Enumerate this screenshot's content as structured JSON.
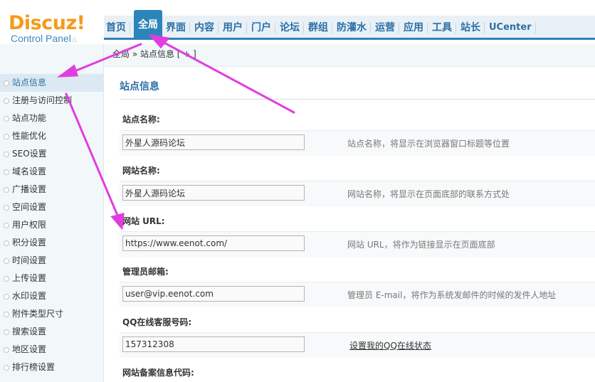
{
  "header": {
    "logo_main": "Discuz!",
    "logo_sub": "Control Panel",
    "home_icon": "home-icon"
  },
  "nav": {
    "items": [
      {
        "label": "首页",
        "active": false
      },
      {
        "label": "全局",
        "active": true
      },
      {
        "label": "界面",
        "active": false
      },
      {
        "label": "内容",
        "active": false
      },
      {
        "label": "用户",
        "active": false
      },
      {
        "label": "门户",
        "active": false
      },
      {
        "label": "论坛",
        "active": false
      },
      {
        "label": "群组",
        "active": false
      },
      {
        "label": "防灌水",
        "active": false
      },
      {
        "label": "运营",
        "active": false
      },
      {
        "label": "应用",
        "active": false
      },
      {
        "label": "工具",
        "active": false
      },
      {
        "label": "站长",
        "active": false
      },
      {
        "label": "UCenter",
        "active": false
      }
    ]
  },
  "breadcrumb": {
    "text": "全局 » 站点信息 [ + ]"
  },
  "sidebar": {
    "items": [
      {
        "label": "站点信息",
        "active": true
      },
      {
        "label": "注册与访问控制"
      },
      {
        "label": "站点功能"
      },
      {
        "label": "性能优化"
      },
      {
        "label": "SEO设置"
      },
      {
        "label": "域名设置"
      },
      {
        "label": "广播设置"
      },
      {
        "label": "空间设置"
      },
      {
        "label": "用户权限"
      },
      {
        "label": "积分设置"
      },
      {
        "label": "时间设置"
      },
      {
        "label": "上传设置"
      },
      {
        "label": "水印设置"
      },
      {
        "label": "附件类型尺寸"
      },
      {
        "label": "搜索设置"
      },
      {
        "label": "地区设置"
      },
      {
        "label": "排行榜设置"
      }
    ]
  },
  "main": {
    "title": "站点信息",
    "fields": [
      {
        "label": "站点名称:",
        "value": "外星人源码论坛",
        "hint": "站点名称，将显示在浏览器窗口标题等位置"
      },
      {
        "label": "网站名称:",
        "value": "外星人源码论坛",
        "hint": "网站名称，将显示在页面底部的联系方式处"
      },
      {
        "label": "网站 URL:",
        "value": "https://www.eenot.com/",
        "hint": "网站 URL，将作为链接显示在页面底部"
      },
      {
        "label": "管理员邮箱:",
        "value": "user@vip.eenot.com",
        "hint": "管理员 E-mail，将作为系统发邮件的时候的发件人地址"
      },
      {
        "label": "QQ在线客服号码:",
        "value": "157312308",
        "link": "设置我的QQ在线状态"
      },
      {
        "label": "网站备案信息代码:"
      }
    ]
  },
  "colors": {
    "accent": "#2b85b8",
    "logo_orange": "#f59a1b",
    "annotation_arrow": "#e03de0"
  }
}
